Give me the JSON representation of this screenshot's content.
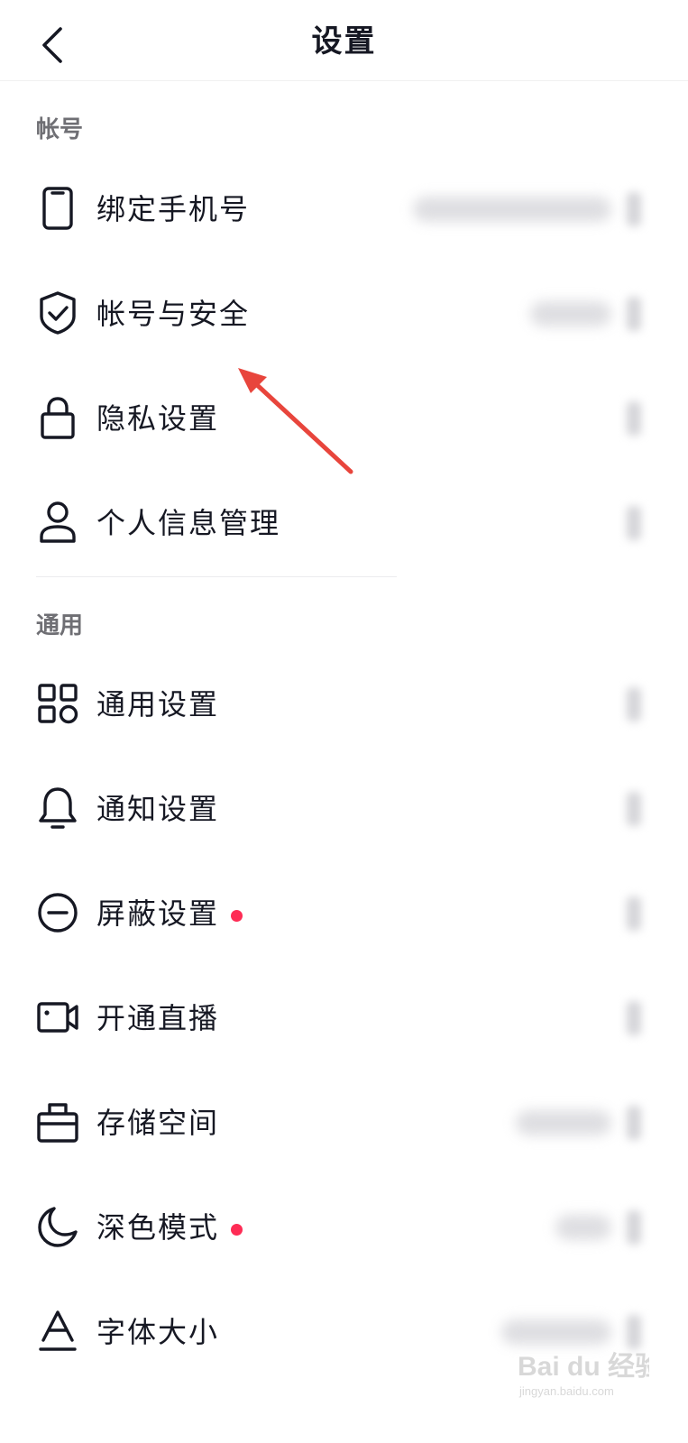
{
  "header": {
    "title": "设置"
  },
  "sections": {
    "account": {
      "title": "帐号",
      "items": [
        {
          "label": "绑定手机号",
          "icon": "phone-icon"
        },
        {
          "label": "帐号与安全",
          "icon": "shield-check-icon"
        },
        {
          "label": "隐私设置",
          "icon": "lock-icon"
        },
        {
          "label": "个人信息管理",
          "icon": "person-icon"
        }
      ]
    },
    "general": {
      "title": "通用",
      "items": [
        {
          "label": "通用设置",
          "icon": "grid-icon"
        },
        {
          "label": "通知设置",
          "icon": "bell-icon"
        },
        {
          "label": "屏蔽设置",
          "icon": "block-icon",
          "badge_dot": true
        },
        {
          "label": "开通直播",
          "icon": "video-camera-icon"
        },
        {
          "label": "存储空间",
          "icon": "storage-box-icon"
        },
        {
          "label": "深色模式",
          "icon": "moon-icon",
          "badge_dot": true
        },
        {
          "label": "字体大小",
          "icon": "font-size-icon"
        }
      ]
    }
  },
  "colors": {
    "accent_dot": "#fe2c55",
    "annotation_arrow": "#e8453c",
    "text_primary": "#161823",
    "section_header": "#6f6f74"
  },
  "watermark": {
    "text": "Bai du 经验",
    "subtext": "jingyan.baidu.com"
  }
}
